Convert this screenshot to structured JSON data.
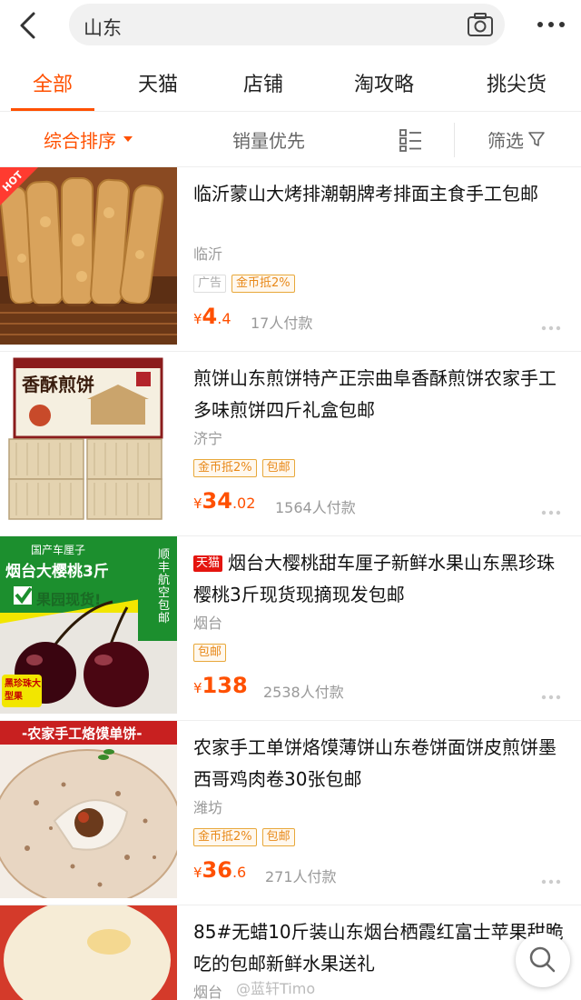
{
  "header": {
    "search_query": "山东"
  },
  "tabs": [
    {
      "label": "全部",
      "active": true
    },
    {
      "label": "天猫",
      "active": false
    },
    {
      "label": "店铺",
      "active": false
    },
    {
      "label": "淘攻略",
      "active": false
    },
    {
      "label": "挑尖货",
      "active": false
    }
  ],
  "sortbar": {
    "comprehensive": "综合排序",
    "sales": "销量优先",
    "filter": "筛选"
  },
  "products": [
    {
      "title": "临沂蒙山大烤排潮朝牌考排面主食手工包邮",
      "location": "临沂",
      "tags": [
        "广告",
        "金币抵2%"
      ],
      "price_int": "4",
      "price_dec": ".4",
      "paid": "17人付款",
      "badge": "HOT"
    },
    {
      "title": "煎饼山东煎饼特产正宗曲阜香酥煎饼农家手工多味煎饼四斤礼盒包邮",
      "location": "济宁",
      "tags": [
        "金币抵2%",
        "包邮"
      ],
      "price_int": "34",
      "price_dec": ".02",
      "paid": "1564人付款",
      "box_text": "香酥煎饼"
    },
    {
      "title": "烟台大樱桃甜车厘子新鲜水果山东黑珍珠樱桃3斤现货现摘现发包邮",
      "tmall_badge": "天猫",
      "location": "烟台",
      "tags": [
        "包邮"
      ],
      "price_int": "138",
      "price_dec": "",
      "paid": "2538人付款",
      "banner_line1": "国产车厘子",
      "banner_line2": "烟台大樱桃3斤",
      "banner_line3": "果园现货!",
      "side_text": "顺丰航空包邮",
      "corner_text": "黑珍珠大型果"
    },
    {
      "title": "农家手工单饼烙馍薄饼山东卷饼面饼皮煎饼墨西哥鸡肉卷30张包邮",
      "location": "潍坊",
      "tags": [
        "金币抵2%",
        "包邮"
      ],
      "price_int": "36",
      "price_dec": ".6",
      "paid": "271人付款",
      "banner": "-农家手工烙馍单饼-"
    },
    {
      "title": "85#无蜡10斤装山东烟台栖霞红富士苹果甜脆吃的包邮新鲜水果送礼",
      "location": "烟台"
    }
  ],
  "watermark": "@蓝轩Timo",
  "colors": {
    "accent": "#ff5000",
    "tmall": "#e4150f",
    "tag": "#e8891a"
  }
}
